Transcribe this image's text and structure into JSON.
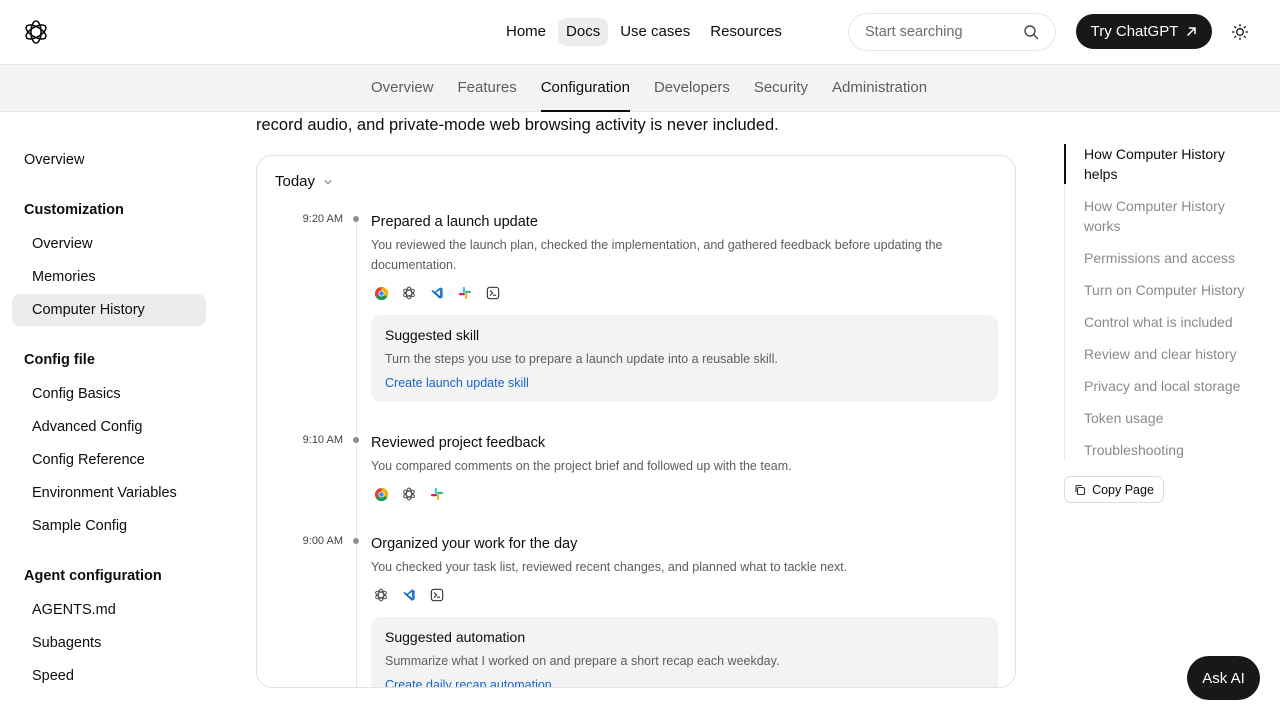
{
  "header": {
    "nav": [
      "Home",
      "Docs",
      "Use cases",
      "Resources"
    ],
    "active_nav": "Docs",
    "search_placeholder": "Start searching",
    "cta_label": "Try ChatGPT"
  },
  "subnav": {
    "tabs": [
      "Overview",
      "Features",
      "Configuration",
      "Developers",
      "Security",
      "Administration"
    ],
    "active": "Configuration"
  },
  "sidebar": {
    "overview": "Overview",
    "sections": [
      {
        "heading": "Customization",
        "items": [
          "Overview",
          "Memories",
          "Computer History"
        ]
      },
      {
        "heading": "Config file",
        "items": [
          "Config Basics",
          "Advanced Config",
          "Config Reference",
          "Environment Variables",
          "Sample Config"
        ]
      },
      {
        "heading": "Agent configuration",
        "items": [
          "AGENTS.md",
          "Subagents",
          "Speed"
        ]
      }
    ],
    "active_item": "Computer History"
  },
  "main": {
    "intro": "record audio, and private-mode web browsing activity is never included.",
    "day_label": "Today",
    "entries": [
      {
        "time": "9:20 AM",
        "title": "Prepared a launch update",
        "desc": "You reviewed the launch plan, checked the implementation, and gathered feedback before updating the documentation.",
        "apps": [
          "chrome-icon",
          "openai-icon",
          "vscode-icon",
          "slack-icon",
          "terminal-icon"
        ],
        "suggestion": {
          "title": "Suggested skill",
          "desc": "Turn the steps you use to prepare a launch update into a reusable skill.",
          "link": "Create launch update skill"
        }
      },
      {
        "time": "9:10 AM",
        "title": "Reviewed project feedback",
        "desc": "You compared comments on the project brief and followed up with the team.",
        "apps": [
          "chrome-icon",
          "openai-icon",
          "slack-icon"
        ]
      },
      {
        "time": "9:00 AM",
        "title": "Organized your work for the day",
        "desc": "You checked your task list, reviewed recent changes, and planned what to tackle next.",
        "apps": [
          "openai-icon",
          "vscode-icon",
          "terminal-icon"
        ],
        "suggestion": {
          "title": "Suggested automation",
          "desc": "Summarize what I worked on and prepare a short recap each weekday.",
          "link": "Create daily recap automation"
        }
      }
    ]
  },
  "toc": {
    "items": [
      "How Computer History helps",
      "How Computer History works",
      "Permissions and access",
      "Turn on Computer History",
      "Control what is included",
      "Review and clear history",
      "Privacy and local storage",
      "Token usage",
      "Troubleshooting"
    ],
    "active": "How Computer History helps",
    "copy_label": "Copy Page"
  },
  "ask_ai_label": "Ask AI",
  "colors": {
    "accent_link": "#1a64c8",
    "button_dark": "#181818",
    "subnav_bg": "#f4f4f4",
    "active_bg": "#ececec"
  }
}
